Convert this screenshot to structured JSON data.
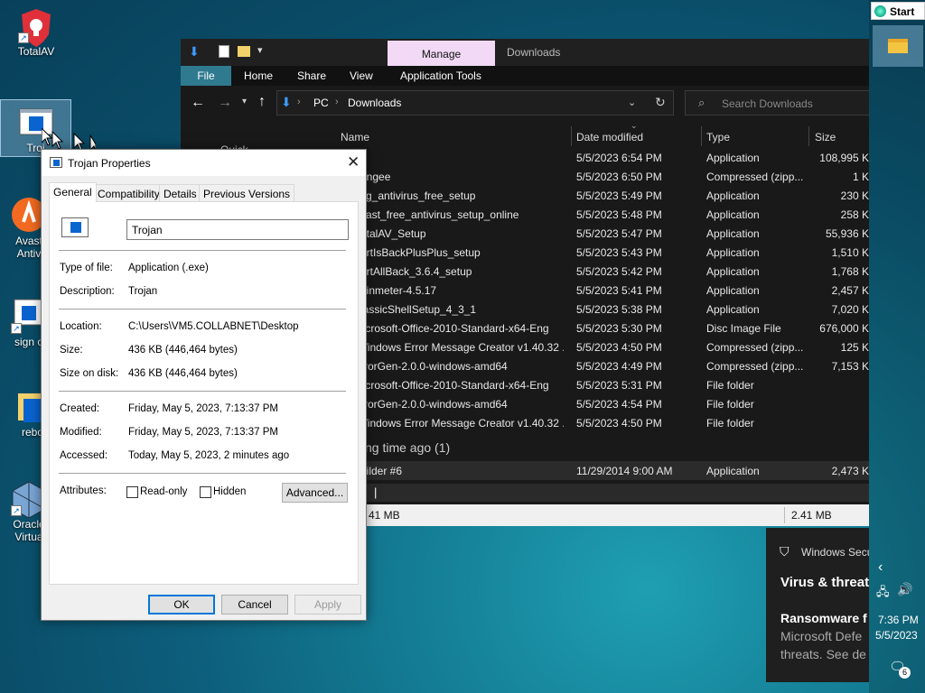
{
  "desktop": {
    "icons": [
      {
        "label": "TotalAV"
      },
      {
        "label": "Troj"
      },
      {
        "label": "Avast\nAntiv"
      },
      {
        "label": "sign o"
      },
      {
        "label": "rebo"
      },
      {
        "label": "Oracle\nVirtua"
      }
    ]
  },
  "start_label": "Start",
  "explorer": {
    "manage_tab": "Manage",
    "title": "Downloads",
    "ribbon": {
      "file": "File",
      "home": "Home",
      "share": "Share",
      "view": "View",
      "tools": "Application Tools"
    },
    "breadcrumb": [
      "PC",
      "Downloads"
    ],
    "search_placeholder": "Search Downloads",
    "columns": {
      "name": "Name",
      "date": "Date modified",
      "type": "Type",
      "size": "Size"
    },
    "rows": [
      {
        "name": "lf",
        "date": "5/5/2023 6:54 PM",
        "type": "Application",
        "size": "108,995 K"
      },
      {
        "name": "ungee",
        "date": "5/5/2023 6:50 PM",
        "type": "Compressed (zipp...",
        "size": "1 K"
      },
      {
        "name": "vg_antivirus_free_setup",
        "date": "5/5/2023 5:49 PM",
        "type": "Application",
        "size": "230 K"
      },
      {
        "name": "vast_free_antivirus_setup_online",
        "date": "5/5/2023 5:48 PM",
        "type": "Application",
        "size": "258 K"
      },
      {
        "name": "otalAV_Setup",
        "date": "5/5/2023 5:47 PM",
        "type": "Application",
        "size": "55,936 K"
      },
      {
        "name": "artIsBackPlusPlus_setup",
        "date": "5/5/2023 5:43 PM",
        "type": "Application",
        "size": "1,510 K"
      },
      {
        "name": "artAllBack_3.6.4_setup",
        "date": "5/5/2023 5:42 PM",
        "type": "Application",
        "size": "1,768 K"
      },
      {
        "name": "ainmeter-4.5.17",
        "date": "5/5/2023 5:41 PM",
        "type": "Application",
        "size": "2,457 K"
      },
      {
        "name": "lassicShellSetup_4_3_1",
        "date": "5/5/2023 5:38 PM",
        "type": "Application",
        "size": "7,020 K"
      },
      {
        "name": "licrosoft-Office-2010-Standard-x64-Eng",
        "date": "5/5/2023 5:30 PM",
        "type": "Disc Image File",
        "size": "676,000 K"
      },
      {
        "name": "Vindows Error Message Creator v1.40.32 ...",
        "date": "5/5/2023 4:50 PM",
        "type": "Compressed (zipp...",
        "size": "125 K"
      },
      {
        "name": "rrorGen-2.0.0-windows-amd64",
        "date": "5/5/2023 4:49 PM",
        "type": "Compressed (zipp...",
        "size": "7,153 K"
      },
      {
        "name": "licrosoft-Office-2010-Standard-x64-Eng",
        "date": "5/5/2023 5:31 PM",
        "type": "File folder",
        "size": ""
      },
      {
        "name": "rrorGen-2.0.0-windows-amd64",
        "date": "5/5/2023 4:54 PM",
        "type": "File folder",
        "size": ""
      },
      {
        "name": "Vindows Error Message Creator v1.40.32 ...",
        "date": "5/5/2023 4:50 PM",
        "type": "File folder",
        "size": ""
      }
    ],
    "group_header": "ng time ago (1)",
    "old_row": {
      "name": "uilder #6",
      "date": "11/29/2014 9:00 AM",
      "type": "Application",
      "size": "2,473 K"
    },
    "sidebar_partial": "Quick",
    "status_left": "41 MB",
    "status_right": "2.41 MB"
  },
  "props": {
    "title": "Trojan Properties",
    "tabs": [
      "General",
      "Compatibility",
      "Details",
      "Previous Versions"
    ],
    "name_value": "Trojan",
    "type_label": "Type of file:",
    "type_value": "Application (.exe)",
    "desc_label": "Description:",
    "desc_value": "Trojan",
    "loc_label": "Location:",
    "loc_value": "C:\\Users\\VM5.COLLABNET\\Desktop",
    "size_label": "Size:",
    "size_value": "436 KB (446,464 bytes)",
    "disk_label": "Size on disk:",
    "disk_value": "436 KB (446,464 bytes)",
    "created_label": "Created:",
    "created_value": "Friday, May 5, 2023, 7:13:37 PM",
    "modified_label": "Modified:",
    "modified_value": "Friday, May 5, 2023, 7:13:37 PM",
    "accessed_label": "Accessed:",
    "accessed_value": "Today, May 5, 2023, 2 minutes ago",
    "attr_label": "Attributes:",
    "readonly_label": "Read-only",
    "hidden_label": "Hidden",
    "advanced_label": "Advanced...",
    "ok": "OK",
    "cancel": "Cancel",
    "apply": "Apply"
  },
  "notification": {
    "app": "Windows Secu",
    "heading": "Virus & threat",
    "sub": "Ransomware f",
    "body1": "Microsoft Defe",
    "body2": "threats.  See de"
  },
  "tray": {
    "time": "7:36 PM",
    "date": "5/5/2023",
    "badge": "6"
  }
}
